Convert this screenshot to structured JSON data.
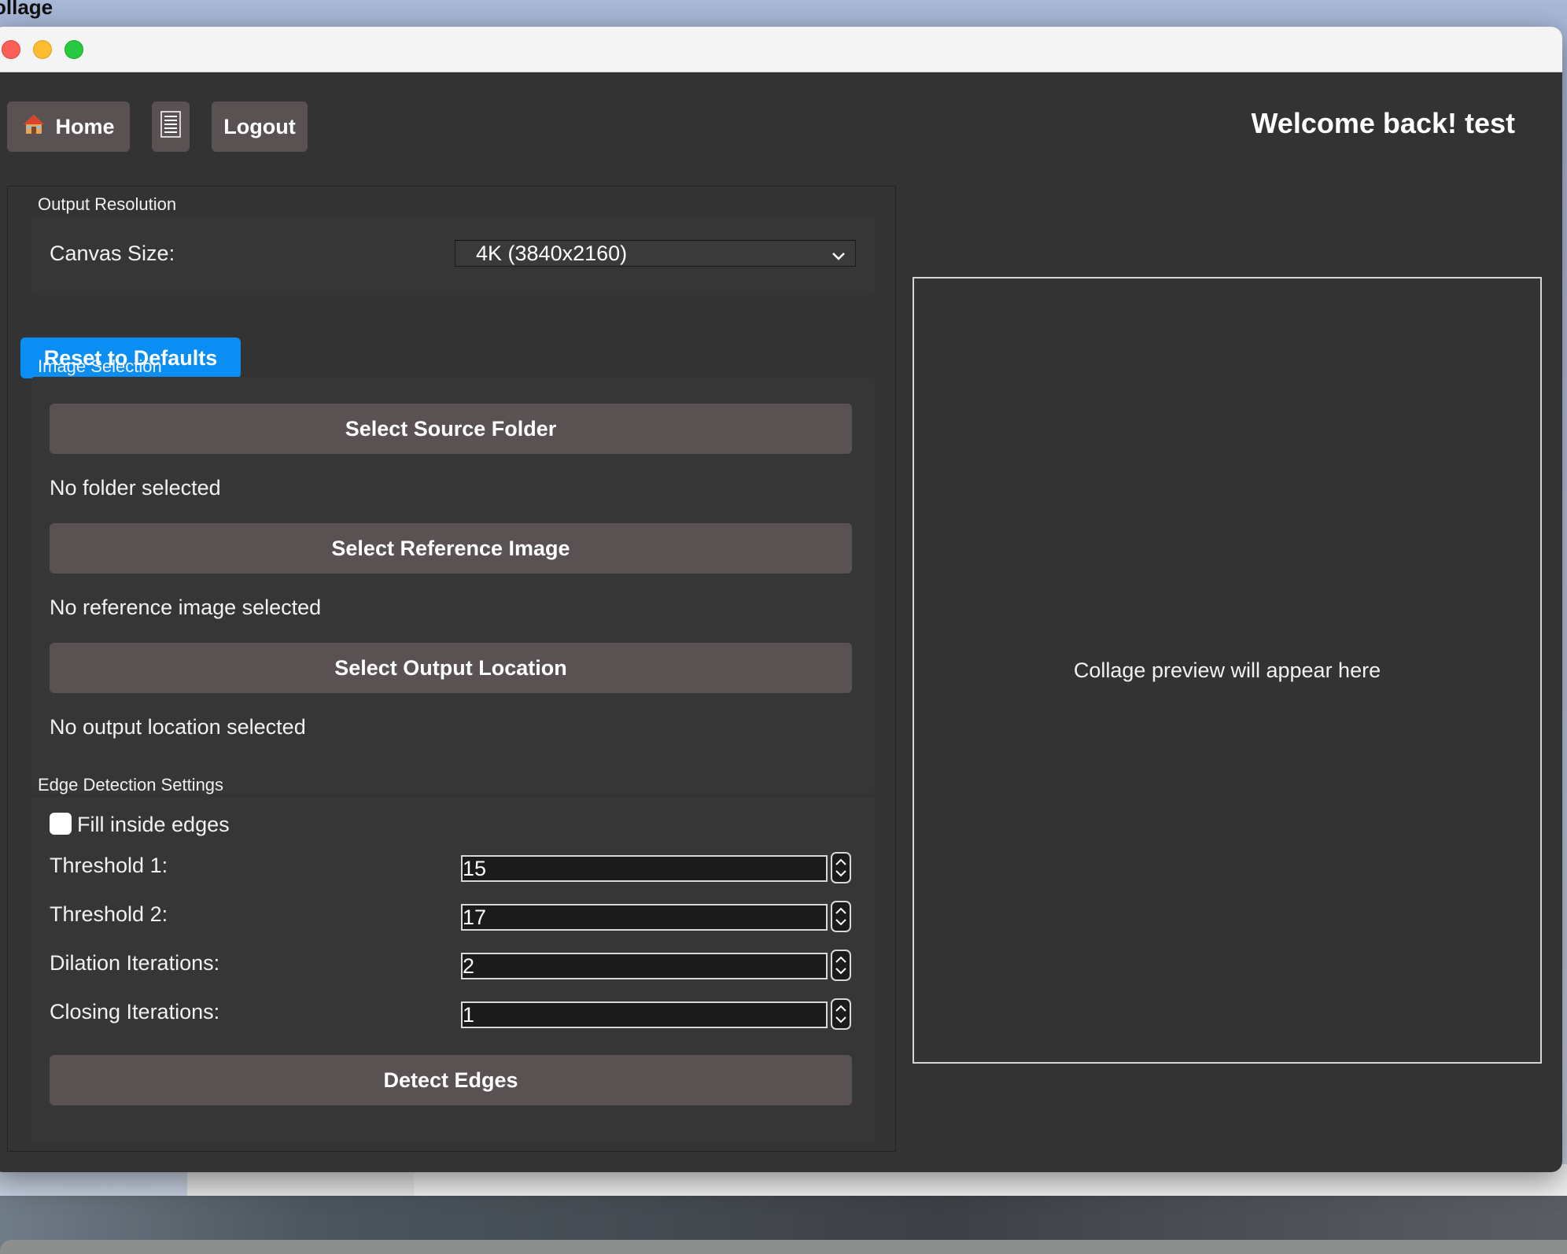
{
  "desktop": {
    "app_title_fragment": "ollage"
  },
  "header": {
    "home_label": "Home",
    "menu_icon": "list-icon",
    "logout_label": "Logout",
    "welcome_text": "Welcome back! test"
  },
  "output_resolution": {
    "section_title": "Output Resolution",
    "canvas_size_label": "Canvas Size:",
    "canvas_size_value": "4K (3840x2160)"
  },
  "reset_button_label": "Reset to Defaults",
  "image_selection": {
    "section_title": "Image Selection",
    "source_button": "Select Source Folder",
    "source_status": "No folder selected",
    "reference_button": "Select Reference Image",
    "reference_status": "No reference image selected",
    "output_button": "Select Output Location",
    "output_status": "No output location selected"
  },
  "edge_detection": {
    "section_title": "Edge Detection Settings",
    "fill_inside_label": "Fill inside edges",
    "fill_inside_checked": false,
    "threshold1_label": "Threshold 1:",
    "threshold1_value": "15",
    "threshold2_label": "Threshold 2:",
    "threshold2_value": "17",
    "dilation_label": "Dilation Iterations:",
    "dilation_value": "2",
    "closing_label": "Closing Iterations:",
    "closing_value": "1",
    "detect_button": "Detect Edges"
  },
  "preview": {
    "placeholder": "Collage preview will appear here"
  },
  "colors": {
    "window_bg": "#333333",
    "button_bg": "#5a5252",
    "accent": "#0a8ef3"
  }
}
